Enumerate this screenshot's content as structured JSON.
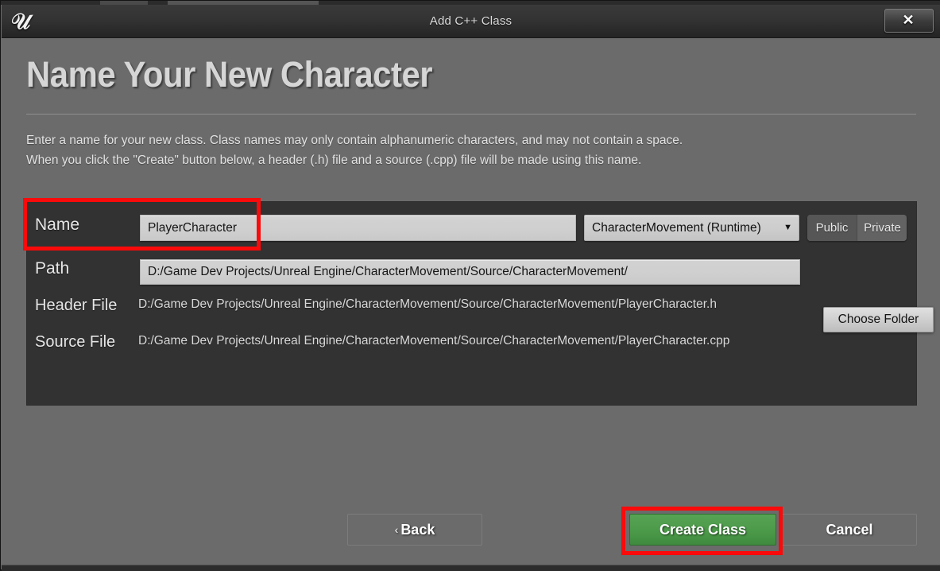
{
  "window": {
    "title": "Add C++ Class",
    "logo_icon": "unreal-engine-logo",
    "close_icon": "✕"
  },
  "page": {
    "heading": "Name Your New Character",
    "description_line1": "Enter a name for your new class. Class names may only contain alphanumeric characters, and may not contain a space.",
    "description_line2": "When you click the \"Create\" button below, a header (.h) file and a source (.cpp) file will be made using this name."
  },
  "form": {
    "name": {
      "label": "Name",
      "value": "PlayerCharacter",
      "placeholder": "Name"
    },
    "module": {
      "selected": "CharacterMovement (Runtime)",
      "arrow_icon": "▼",
      "options": [
        "CharacterMovement (Runtime)"
      ]
    },
    "access": {
      "public_label": "Public",
      "private_label": "Private",
      "selected": "Private"
    },
    "path": {
      "label": "Path",
      "value": "D:/Game Dev Projects/Unreal Engine/CharacterMovement/Source/CharacterMovement/",
      "placeholder": "Path"
    },
    "choose_folder_label": "Choose Folder",
    "header_file": {
      "label": "Header File",
      "value": "D:/Game Dev Projects/Unreal Engine/CharacterMovement/Source/CharacterMovement/PlayerCharacter.h"
    },
    "source_file": {
      "label": "Source File",
      "value": "D:/Game Dev Projects/Unreal Engine/CharacterMovement/Source/CharacterMovement/PlayerCharacter.cpp"
    }
  },
  "footer": {
    "back_label": "Back",
    "back_chevron": "‹",
    "create_label": "Create Class",
    "cancel_label": "Cancel"
  },
  "annotations": {
    "color": "#fa0a0a",
    "highlighted": [
      "name-field",
      "create-class-button"
    ]
  },
  "colors": {
    "window_background": "#6b6b6b",
    "panel_background": "#323232",
    "titlebar": "#333333",
    "create_button_green": "#4b9a49",
    "input_background": "#cfcfcf",
    "annotation_red": "#fa0a0a"
  }
}
